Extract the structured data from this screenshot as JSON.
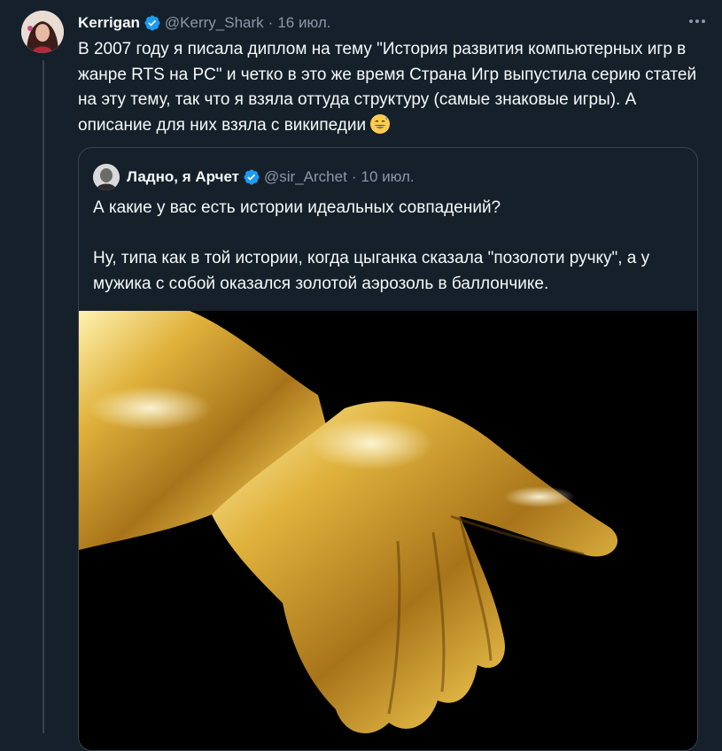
{
  "tweet": {
    "author_name": "Kerrigan",
    "author_handle": "@Kerry_Shark",
    "date": "16 июл.",
    "text": "В 2007 году я писала диплом на тему \"История развития компьютерных игр в жанре RTS на PC\" и четко в это же время Страна Игр выпустила серию статей на эту тему, так что я взяла оттуда структуру (самые знаковые игры). А описание для них взяла с википедии",
    "emoji": "grinning-sweat-emoji",
    "verified": true
  },
  "quoted": {
    "author_name": "Ладно, я Арчет",
    "author_handle": "@sir_Archet",
    "date": "10 июл.",
    "text": "А какие у вас есть истории идеальных совпадений?\n\nНу, типа как в той истории, когда цыганка сказала \"позолоти ручку\", а у мужика с собой оказался золотой аэрозоль в баллончике.",
    "media": "golden-hand-image",
    "verified": true
  },
  "icons": {
    "more": "more-dots-icon",
    "verified": "verified-badge-icon"
  },
  "colors": {
    "background": "#15202b",
    "text": "#f7f9f9",
    "muted": "#8b98a5",
    "border": "#38444d",
    "verified": "#1d9bf0",
    "gold": "#d4a52a"
  }
}
